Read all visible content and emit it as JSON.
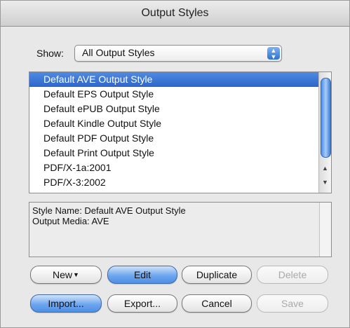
{
  "window": {
    "title": "Output Styles"
  },
  "show": {
    "label": "Show:",
    "selected_value": "All Output Styles",
    "arrow_up": "▲",
    "arrow_down": "▼"
  },
  "styles_list": {
    "selected_index": 0,
    "items": [
      "Default AVE Output Style",
      "Default EPS Output Style",
      "Default ePUB Output Style",
      "Default Kindle Output Style",
      "Default PDF Output Style",
      "Default Print Output Style",
      "PDF/X-1a:2001",
      "PDF/X-3:2002"
    ],
    "scroll_up": "▲",
    "scroll_down": "▼"
  },
  "details": {
    "style_name_line": "Style Name: Default AVE Output Style",
    "output_media_line": "Output Media: AVE"
  },
  "buttons": {
    "new": {
      "label": "New",
      "caret": "▼",
      "enabled": true
    },
    "edit": {
      "label": "Edit",
      "enabled": true,
      "highlighted": true
    },
    "duplicate": {
      "label": "Duplicate",
      "enabled": true
    },
    "delete": {
      "label": "Delete",
      "enabled": false
    },
    "import": {
      "label": "Import...",
      "enabled": true,
      "highlighted": true
    },
    "export": {
      "label": "Export...",
      "enabled": true
    },
    "cancel": {
      "label": "Cancel",
      "enabled": true
    },
    "save": {
      "label": "Save",
      "enabled": false
    }
  }
}
